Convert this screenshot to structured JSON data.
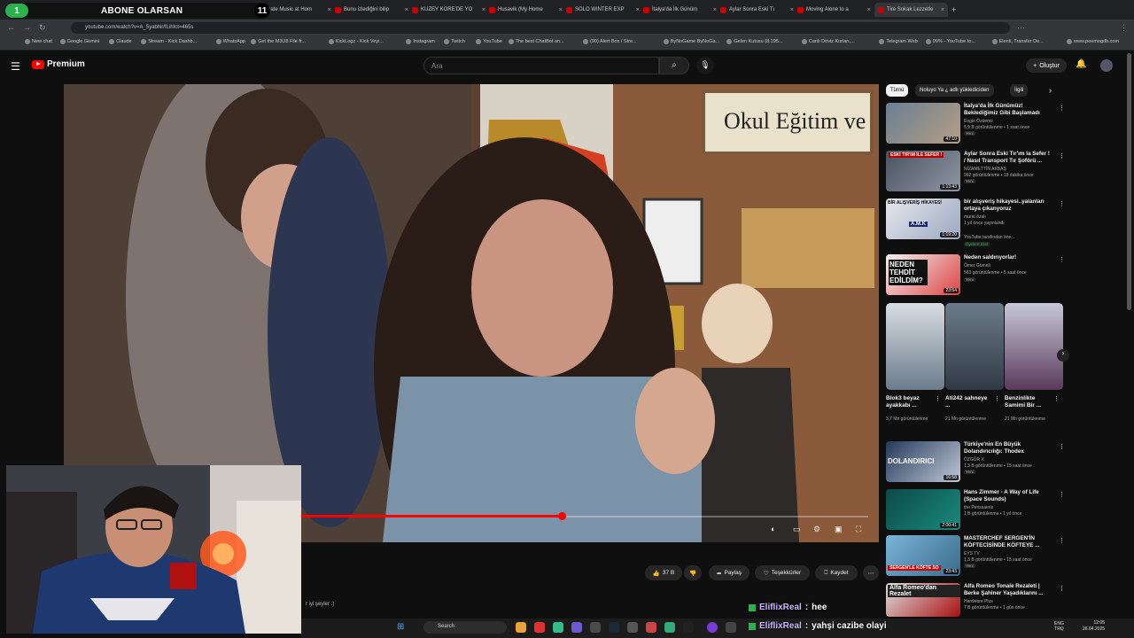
{
  "overlay": {
    "left_count": "1",
    "subscribe_text": "ABONE OLARSAN",
    "right_count": "11"
  },
  "browser": {
    "tabs": [
      {
        "label": "The Most Beautiful"
      },
      {
        "label": "Mercin, Tarı Remix"
      },
      {
        "label": "dıklarım Doğurdu"
      },
      {
        "label": "Date Music at Hom"
      },
      {
        "label": "Bunu izlediğini bilip"
      },
      {
        "label": "KUZEY KORE'DE YO"
      },
      {
        "label": "Husavik (My Home"
      },
      {
        "label": "SOLO WINTER EXP"
      },
      {
        "label": "İtalya'da İlk Günüm"
      },
      {
        "label": "Aylar Sonra Eski Tı"
      },
      {
        "label": "Moving Alone to a"
      },
      {
        "label": "Tire Sokak Lezzetle"
      }
    ],
    "url": "youtube.com/watch?v=A_5yabNr/fLihfct=465s",
    "bookmarks": [
      "New chat",
      "Google Gemini",
      "Claude",
      "Stream - Kick Dashb...",
      "WhatsApp",
      "Get the M3U8 File fr...",
      "KickLogz - Kick Veyi...",
      "Instagram",
      "Twitch",
      "YouTube",
      "The best ChatBot an...",
      "(90) Alert Box / Stre...",
      "ByNoGame ByNoGa...",
      "Gelen Kutusu (8.195...",
      "Canlı Döviz Kurları,...",
      "Telegram Web",
      "99% - YouTube to...",
      "Elenti, Transfer De...",
      "www.peemogdb.com"
    ]
  },
  "youtube": {
    "brand": "Premium",
    "search_placeholder": "Ara",
    "create_label": "Oluştur",
    "actions": {
      "likes": "37 B",
      "share": "Paylaş",
      "thanks": "Teşekkürler",
      "save": "Kaydet"
    },
    "comment_snippet": "r iyi şeyler :)",
    "chips": [
      {
        "label": "Tümü",
        "active": true
      },
      {
        "label": "Noluyo Ya ¿ adlı yüklediciden",
        "active": false
      },
      {
        "label": "İlgili",
        "active": false
      }
    ],
    "recommendations": [
      {
        "title": "İtalya'da İlk Günümüz! Beklediğimiz Gibi Başlamadı",
        "channel": "Engin Özdemir",
        "meta": "5,9 B görüntülenme • 1 saat önce",
        "badge": "Yeni",
        "duration": "47:10"
      },
      {
        "title": "Aylar Sonra Eski Tır'ım la Sefer ! / Nasıl Transport Tır Şoförü ...",
        "channel": "NİZAMETTİN AKBAŞ",
        "meta": "992 görüntülenme • 18 dakika önce",
        "badge": "Yeni",
        "duration": "1:13:43"
      },
      {
        "title": "bir alışveriş hikayesi..yalanları ortaya çıkanyoruz",
        "channel": "murat özalı",
        "meta": "1 yıl önce yayınlandı",
        "badge": "Üyelere özel",
        "duration": "1:19:20",
        "extra": "YouTube tarafından öne..."
      },
      {
        "title": "Neden saldırıyorlar!",
        "channel": "Ömer Gümeli",
        "meta": "583 görüntülenme • 5 saat önce",
        "badge": "Yeni",
        "duration": "23:54"
      },
      {
        "title": "Türkiye'nin En Büyük Dolandırıcılığı: Thodex",
        "channel": "ÖZGÜR X",
        "meta": "1,3 B görüntülenme • 15 saat önce",
        "badge": "Yeni",
        "duration": "16:58"
      },
      {
        "title": "Hans Zimmer - A Way of Life (Space Sounds)",
        "channel": "the Perissaeris",
        "meta": "1 B görüntülenme • 1 yıl önce",
        "badge": "",
        "duration": "2:00:41"
      },
      {
        "title": "MASTERCHEF SERGEN'İN KÖFTECİSİNDE KÖFTEYE ...",
        "channel": "EYS TV",
        "meta": "1,3 B görüntülenme • 15 saat önce",
        "badge": "Yeni",
        "duration": "23:43"
      },
      {
        "title": "Alfa Romeo Tonale Rezaleti | Berke Şahiner Yaşadıklarını ...",
        "channel": "Hardware Plus",
        "meta": "7 B görüntülenme • 1 gün önce",
        "badge": "",
        "duration": ""
      }
    ],
    "shorts": [
      {
        "title": "Blok3 beyaz ayakkabı ...",
        "views": "3,7 Mn görüntülenme"
      },
      {
        "title": "Ati242 sahneye ...",
        "views": "21 Mn görüntülenme"
      },
      {
        "title": "Benzinlikte Samimi Bir ...",
        "views": "21 Mn görüntülenme"
      }
    ],
    "thumb_texts": {
      "t2": "ESKİ TIR'IM İLE SEFER !",
      "t3a": "BİR ALIŞVERİŞ HİKAYESİ",
      "t3b": "A.M.K",
      "t4": "NEDEN TEHDİT EDİLDİM?",
      "t5": "DOLANDIRICI",
      "t7": "SERGEN'LE KÖFTE SO",
      "t8": "Alfa Romeo'dan Rezalet"
    },
    "video_sign": "Okul Eğitim ve"
  },
  "chat": [
    {
      "user": "EliflixReal",
      "message": "hee"
    },
    {
      "user": "EliflixReal",
      "message": "yahşi cazibe olayi"
    }
  ],
  "taskbar": {
    "search": "Search",
    "lang": "ENG\nTRQ",
    "time": "12:05",
    "date": "26.04.2025"
  },
  "colors": {
    "brand_red": "#ff0000",
    "kick_green": "#2bb24c"
  }
}
